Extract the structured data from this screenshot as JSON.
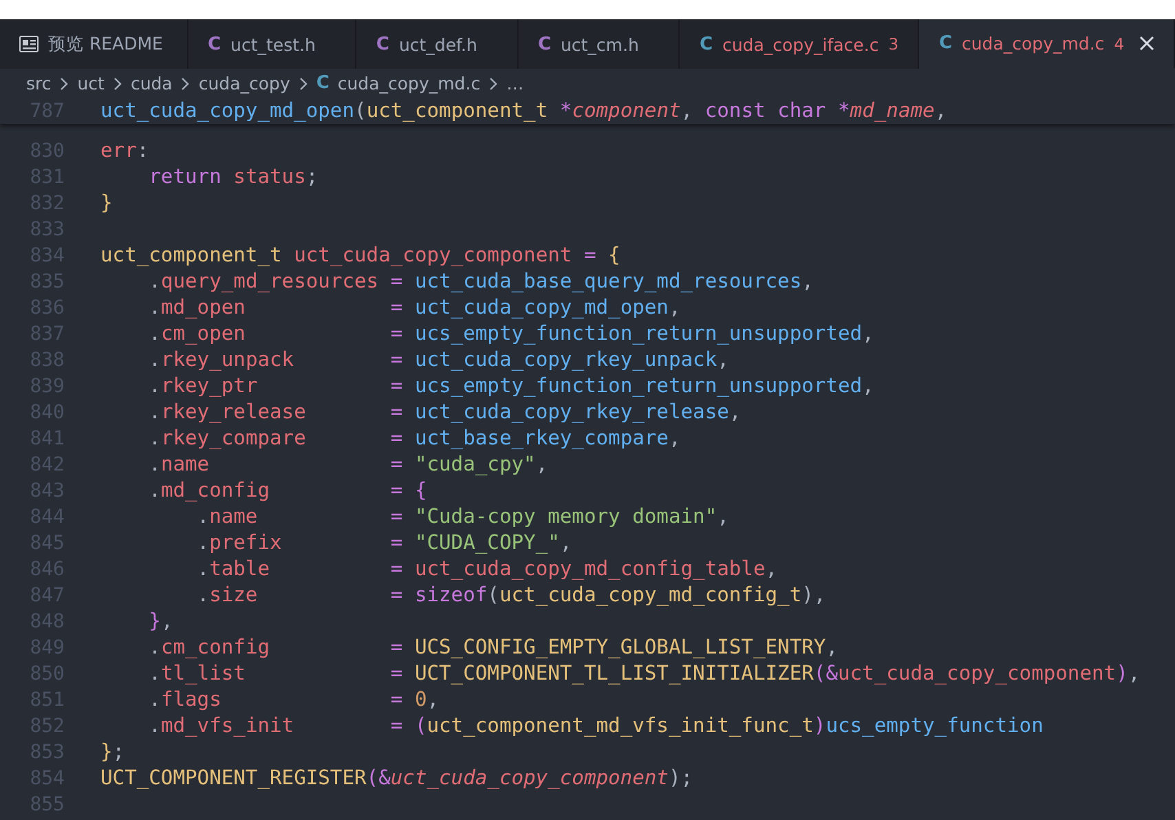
{
  "tabs": [
    {
      "kind": "preview",
      "label": "预览 README",
      "error": false,
      "selected": false
    },
    {
      "kind": "c",
      "icon_text": "C",
      "color": "#a074c4",
      "label": "uct_test.h",
      "error": false,
      "selected": false
    },
    {
      "kind": "c",
      "icon_text": "C",
      "color": "#a074c4",
      "label": "uct_def.h",
      "error": false,
      "selected": false
    },
    {
      "kind": "c",
      "icon_text": "C",
      "color": "#a074c4",
      "label": "uct_cm.h",
      "error": false,
      "selected": false
    },
    {
      "kind": "c",
      "icon_text": "C",
      "color": "#519aba",
      "label": "cuda_copy_iface.c",
      "badge": "3",
      "error": true,
      "selected": false
    },
    {
      "kind": "c",
      "icon_text": "C",
      "color": "#519aba",
      "label": "cuda_copy_md.c",
      "badge": "4",
      "error": true,
      "selected": true
    }
  ],
  "breadcrumb": {
    "parts": [
      "src",
      "uct",
      "cuda",
      "cuda_copy"
    ],
    "file_icon": "C",
    "file": "cuda_copy_md.c",
    "more": "…"
  },
  "sticky_line": {
    "number": "787",
    "tokens": [
      {
        "kind": "function",
        "text": "uct_cuda_copy_md_open"
      },
      {
        "kind": "plain",
        "text": "("
      },
      {
        "kind": "type",
        "text": "uct_component_t "
      },
      {
        "kind": "keyword",
        "text": "*"
      },
      {
        "kind": "param",
        "text": "component"
      },
      {
        "kind": "plain",
        "text": ", "
      },
      {
        "kind": "keyword",
        "text": "const char *"
      },
      {
        "kind": "param",
        "text": "md_name"
      },
      {
        "kind": "plain",
        "text": ","
      }
    ]
  },
  "lines": [
    {
      "number": "830",
      "tokens": [
        {
          "kind": "variable",
          "text": "err"
        },
        {
          "kind": "plain",
          "text": ":"
        }
      ]
    },
    {
      "number": "831",
      "tokens": [
        {
          "kind": "keyword",
          "text": "    return "
        },
        {
          "kind": "variable",
          "text": "status"
        },
        {
          "kind": "plain",
          "text": ";"
        }
      ]
    },
    {
      "number": "832",
      "tokens": [
        {
          "kind": "type",
          "text": "}"
        }
      ]
    },
    {
      "number": "833"
    },
    {
      "number": "834",
      "tokens": [
        {
          "kind": "type",
          "text": "uct_component_t "
        },
        {
          "kind": "variable",
          "text": "uct_cuda_copy_component "
        },
        {
          "kind": "keyword",
          "text": "= "
        },
        {
          "kind": "type",
          "text": "{"
        }
      ]
    },
    {
      "number": "835",
      "tokens": [
        {
          "kind": "plain",
          "text": "    ."
        },
        {
          "kind": "variable",
          "text": "query_md_resources "
        },
        {
          "kind": "keyword",
          "text": "= "
        },
        {
          "kind": "function",
          "text": "uct_cuda_base_query_md_resources"
        },
        {
          "kind": "plain",
          "text": ","
        }
      ]
    },
    {
      "number": "836",
      "tokens": [
        {
          "kind": "plain",
          "text": "    ."
        },
        {
          "kind": "variable",
          "text": "md_open            "
        },
        {
          "kind": "keyword",
          "text": "= "
        },
        {
          "kind": "function",
          "text": "uct_cuda_copy_md_open"
        },
        {
          "kind": "plain",
          "text": ","
        }
      ]
    },
    {
      "number": "837",
      "tokens": [
        {
          "kind": "plain",
          "text": "    ."
        },
        {
          "kind": "variable",
          "text": "cm_open            "
        },
        {
          "kind": "keyword",
          "text": "= "
        },
        {
          "kind": "function",
          "text": "ucs_empty_function_return_unsupported"
        },
        {
          "kind": "plain",
          "text": ","
        }
      ]
    },
    {
      "number": "838",
      "tokens": [
        {
          "kind": "plain",
          "text": "    ."
        },
        {
          "kind": "variable",
          "text": "rkey_unpack        "
        },
        {
          "kind": "keyword",
          "text": "= "
        },
        {
          "kind": "function",
          "text": "uct_cuda_copy_rkey_unpack"
        },
        {
          "kind": "plain",
          "text": ","
        }
      ]
    },
    {
      "number": "839",
      "tokens": [
        {
          "kind": "plain",
          "text": "    ."
        },
        {
          "kind": "variable",
          "text": "rkey_ptr           "
        },
        {
          "kind": "keyword",
          "text": "= "
        },
        {
          "kind": "function",
          "text": "ucs_empty_function_return_unsupported"
        },
        {
          "kind": "plain",
          "text": ","
        }
      ]
    },
    {
      "number": "840",
      "tokens": [
        {
          "kind": "plain",
          "text": "    ."
        },
        {
          "kind": "variable",
          "text": "rkey_release       "
        },
        {
          "kind": "keyword",
          "text": "= "
        },
        {
          "kind": "function",
          "text": "uct_cuda_copy_rkey_release"
        },
        {
          "kind": "plain",
          "text": ","
        }
      ]
    },
    {
      "number": "841",
      "tokens": [
        {
          "kind": "plain",
          "text": "    ."
        },
        {
          "kind": "variable",
          "text": "rkey_compare       "
        },
        {
          "kind": "keyword",
          "text": "= "
        },
        {
          "kind": "function",
          "text": "uct_base_rkey_compare"
        },
        {
          "kind": "plain",
          "text": ","
        }
      ]
    },
    {
      "number": "842",
      "tokens": [
        {
          "kind": "plain",
          "text": "    ."
        },
        {
          "kind": "variable",
          "text": "name               "
        },
        {
          "kind": "keyword",
          "text": "= "
        },
        {
          "kind": "string",
          "text": "\"cuda_cpy\""
        },
        {
          "kind": "plain",
          "text": ","
        }
      ]
    },
    {
      "number": "843",
      "tokens": [
        {
          "kind": "plain",
          "text": "    ."
        },
        {
          "kind": "variable",
          "text": "md_config          "
        },
        {
          "kind": "keyword",
          "text": "= {"
        }
      ]
    },
    {
      "number": "844",
      "tokens": [
        {
          "kind": "plain",
          "text": "        ."
        },
        {
          "kind": "variable",
          "text": "name           "
        },
        {
          "kind": "keyword",
          "text": "= "
        },
        {
          "kind": "string",
          "text": "\"Cuda-copy memory domain\""
        },
        {
          "kind": "plain",
          "text": ","
        }
      ]
    },
    {
      "number": "845",
      "tokens": [
        {
          "kind": "plain",
          "text": "        ."
        },
        {
          "kind": "variable",
          "text": "prefix         "
        },
        {
          "kind": "keyword",
          "text": "= "
        },
        {
          "kind": "string",
          "text": "\"CUDA_COPY_\""
        },
        {
          "kind": "plain",
          "text": ","
        }
      ]
    },
    {
      "number": "846",
      "tokens": [
        {
          "kind": "plain",
          "text": "        ."
        },
        {
          "kind": "variable",
          "text": "table          "
        },
        {
          "kind": "keyword",
          "text": "= "
        },
        {
          "kind": "variable",
          "text": "uct_cuda_copy_md_config_table"
        },
        {
          "kind": "plain",
          "text": ","
        }
      ]
    },
    {
      "number": "847",
      "tokens": [
        {
          "kind": "plain",
          "text": "        ."
        },
        {
          "kind": "variable",
          "text": "size           "
        },
        {
          "kind": "keyword",
          "text": "= sizeof"
        },
        {
          "kind": "plain",
          "text": "("
        },
        {
          "kind": "type",
          "text": "uct_cuda_copy_md_config_t"
        },
        {
          "kind": "plain",
          "text": "),"
        }
      ]
    },
    {
      "number": "848",
      "tokens": [
        {
          "kind": "keyword",
          "text": "    }"
        },
        {
          "kind": "plain",
          "text": ","
        }
      ]
    },
    {
      "number": "849",
      "tokens": [
        {
          "kind": "plain",
          "text": "    ."
        },
        {
          "kind": "variable",
          "text": "cm_config          "
        },
        {
          "kind": "keyword",
          "text": "= "
        },
        {
          "kind": "type",
          "text": "UCS_CONFIG_EMPTY_GLOBAL_LIST_ENTRY"
        },
        {
          "kind": "plain",
          "text": ","
        }
      ]
    },
    {
      "number": "850",
      "tokens": [
        {
          "kind": "plain",
          "text": "    ."
        },
        {
          "kind": "variable",
          "text": "tl_list            "
        },
        {
          "kind": "keyword",
          "text": "= "
        },
        {
          "kind": "type",
          "text": "UCT_COMPONENT_TL_LIST_INITIALIZER"
        },
        {
          "kind": "keyword",
          "text": "(&"
        },
        {
          "kind": "variable",
          "text": "uct_cuda_copy_component"
        },
        {
          "kind": "keyword",
          "text": ")"
        },
        {
          "kind": "plain",
          "text": ","
        }
      ]
    },
    {
      "number": "851",
      "tokens": [
        {
          "kind": "plain",
          "text": "    ."
        },
        {
          "kind": "variable",
          "text": "flags              "
        },
        {
          "kind": "keyword",
          "text": "= "
        },
        {
          "kind": "number",
          "text": "0"
        },
        {
          "kind": "plain",
          "text": ","
        }
      ]
    },
    {
      "number": "852",
      "tokens": [
        {
          "kind": "plain",
          "text": "    ."
        },
        {
          "kind": "variable",
          "text": "md_vfs_init        "
        },
        {
          "kind": "keyword",
          "text": "= ("
        },
        {
          "kind": "type",
          "text": "uct_component_md_vfs_init_func_t"
        },
        {
          "kind": "keyword",
          "text": ")"
        },
        {
          "kind": "function",
          "text": "ucs_empty_function"
        }
      ]
    },
    {
      "number": "853",
      "tokens": [
        {
          "kind": "type",
          "text": "}"
        },
        {
          "kind": "plain",
          "text": ";"
        }
      ]
    },
    {
      "number": "854",
      "tokens": [
        {
          "kind": "type",
          "text": "UCT_COMPONENT_REGISTER"
        },
        {
          "kind": "keyword",
          "text": "(&"
        },
        {
          "kind": "param",
          "text": "uct_cuda_copy_component"
        },
        {
          "kind": "plain",
          "text": ");"
        }
      ]
    },
    {
      "number": "855"
    }
  ]
}
